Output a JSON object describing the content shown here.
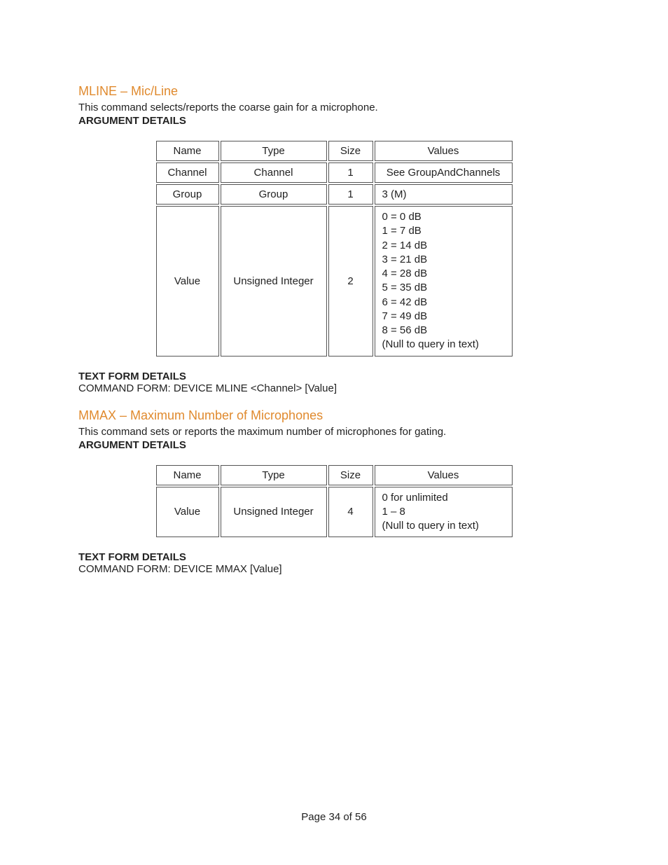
{
  "mline": {
    "title": "MLINE – Mic/Line",
    "desc": "This command selects/reports the coarse gain for a microphone.",
    "arg_head": "ARGUMENT DETAILS",
    "headers": {
      "name": "Name",
      "type": "Type",
      "size": "Size",
      "values": "Values"
    },
    "rows": [
      {
        "name": "Channel",
        "type": "Channel",
        "size": "1",
        "values": "See GroupAndChannels"
      },
      {
        "name": "Group",
        "type": "Group",
        "size": "1",
        "values": "3 (M)"
      },
      {
        "name": "Value",
        "type": "Unsigned Integer",
        "size": "2",
        "values": "0 = 0 dB\n1 = 7 dB\n2 = 14 dB\n3 = 21 dB\n4 = 28 dB\n5 = 35 dB\n6 = 42 dB\n7 = 49 dB\n8 = 56 dB\n(Null to query in text)"
      }
    ],
    "textform_head": "TEXT FORM DETAILS",
    "textform": "COMMAND FORM: DEVICE MLINE <Channel> [Value]"
  },
  "mmax": {
    "title": "MMAX – Maximum Number of Microphones",
    "desc": "This command sets or reports the maximum number of microphones for gating.",
    "arg_head": "ARGUMENT DETAILS",
    "headers": {
      "name": "Name",
      "type": "Type",
      "size": "Size",
      "values": "Values"
    },
    "rows": [
      {
        "name": "Value",
        "type": "Unsigned Integer",
        "size": "4",
        "values": "0 for unlimited\n1 – 8\n(Null to query in text)"
      }
    ],
    "textform_head": "TEXT FORM DETAILS",
    "textform": "COMMAND FORM: DEVICE MMAX [Value]"
  },
  "footer": "Page 34 of 56"
}
